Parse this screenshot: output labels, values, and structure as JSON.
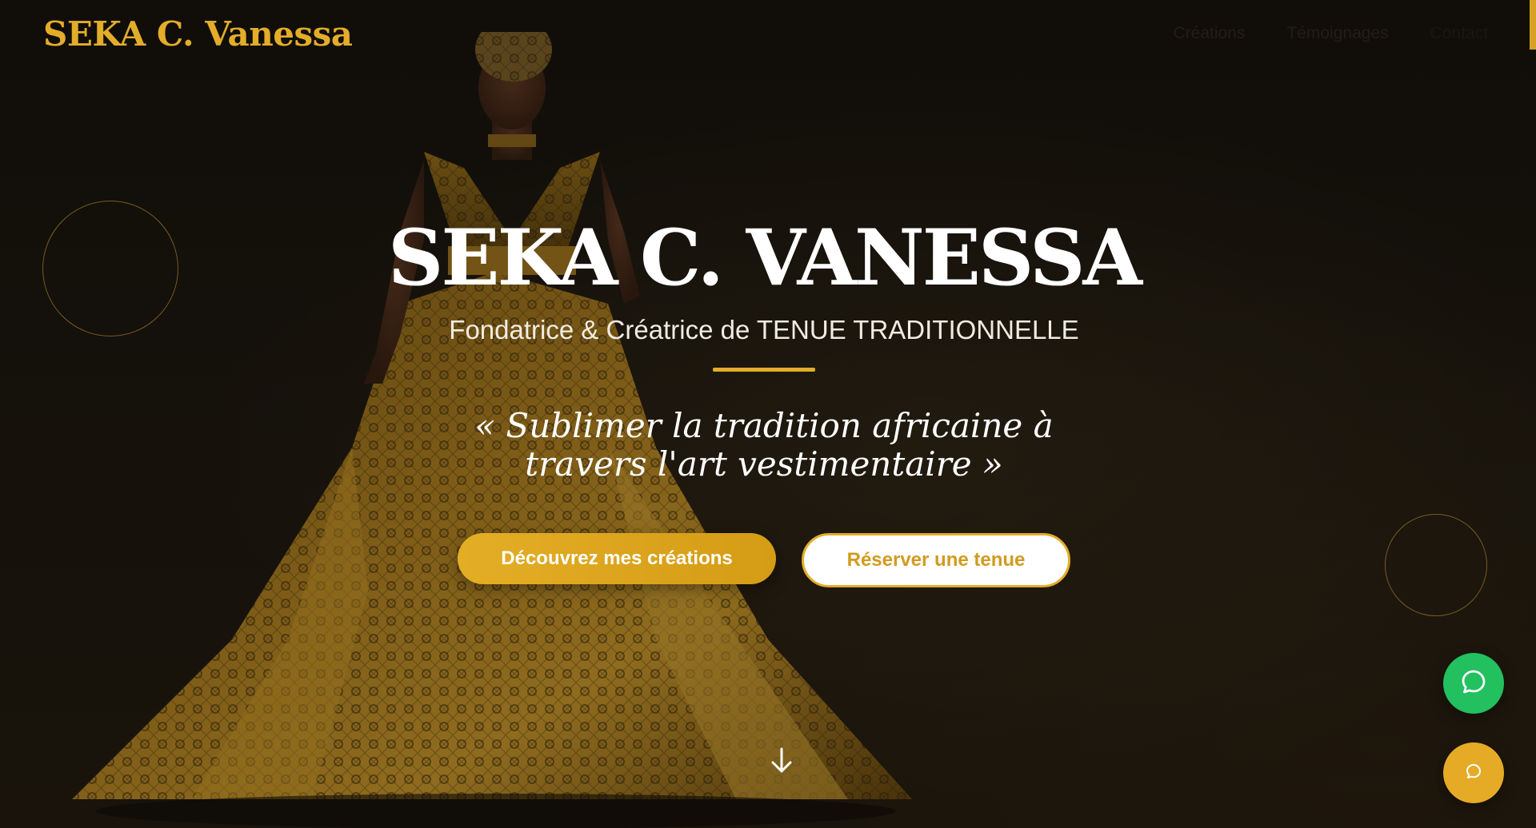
{
  "header": {
    "brand": "SEKA C. Vanessa",
    "nav": [
      {
        "label": "Créations"
      },
      {
        "label": "Témoignages"
      },
      {
        "label": "Contact"
      }
    ]
  },
  "hero": {
    "title": "SEKA C. VANESSA",
    "subtitle": "Fondatrice & Créatrice de TENUE TRADITIONNELLE",
    "quote": "« Sublimer la tradition africaine à travers l'art vestimentaire »",
    "primary_cta": "Découvrez mes créations",
    "secondary_cta": "Réserver une tenue"
  },
  "icons": {
    "scroll": "arrow-down-icon",
    "whatsapp": "chat-bubble-icon",
    "chat": "chat-bubble-small-icon"
  },
  "colors": {
    "accent": "#e3ad2a",
    "background": "#17130d",
    "whatsapp": "#22c05f"
  }
}
